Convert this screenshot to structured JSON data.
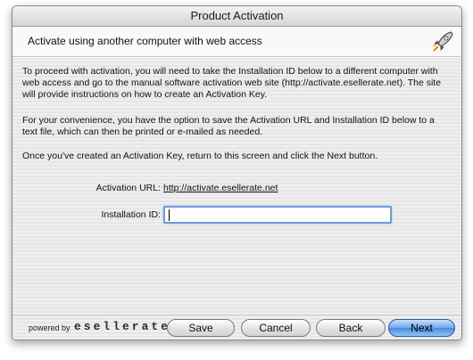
{
  "window": {
    "title": "Product Activation"
  },
  "header": {
    "text": "Activate using another computer with web access",
    "icon": "rocket-icon"
  },
  "instructions": {
    "paragraph1": "To proceed with activation, you will need to take the Installation ID below to a different computer with web access and go to the manual software activation web site (http://activate.esellerate.net). The site will provide instructions on how to create an Activation Key.",
    "paragraph2": "For your convenience, you have the option to save the Activation URL and Installation ID below to a text file, which can then be printed or e-mailed as needed.",
    "paragraph3": "Once you've created an Activation Key, return to this screen and click the Next button."
  },
  "form": {
    "url_label": "Activation URL:",
    "url_value": "http://activate.esellerate.net",
    "id_label": "Installation ID:",
    "id_value": ""
  },
  "footer": {
    "powered_by": "powered by",
    "brand": "esellerate",
    "save_label": "Save",
    "cancel_label": "Cancel",
    "back_label": "Back",
    "next_label": "Next"
  },
  "colors": {
    "default_button_accent": "#4a8be0",
    "focus_ring": "#6f9ad6"
  }
}
